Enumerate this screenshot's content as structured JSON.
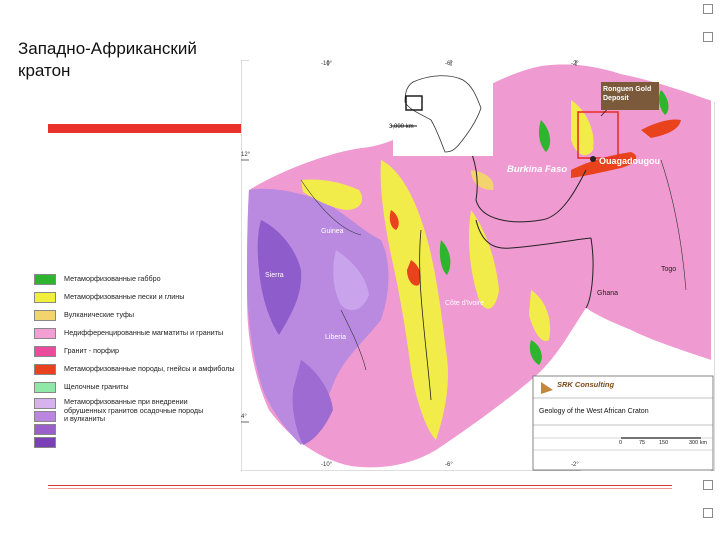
{
  "slide": {
    "title": "Западно-Африканский кратон"
  },
  "map": {
    "labels": {
      "burkina_faso": "Burkina Faso",
      "ouagadougou": "Ouagadougou",
      "deposit": "Ronguen Gold Deposit",
      "togo": "Togo",
      "ghana": "Ghana",
      "cote": "Côte d'Ivoire",
      "liberia": "Liberia",
      "guinea": "Guinea",
      "sierra": "Sierra"
    },
    "lat_labels": [
      "12°",
      "4°"
    ],
    "lon_labels_top": [
      "-10°",
      "-6°",
      "-2°"
    ],
    "lon_labels_bottom": [
      "-10°",
      "-6°",
      "-2°"
    ],
    "inset_scale": "3,000 km",
    "company": "SRK Consulting",
    "map_title": "Geology of the West African Craton",
    "scale_ticks": [
      "0",
      "75",
      "150",
      "300 km"
    ]
  },
  "legend": {
    "items": [
      {
        "label": "Метаморфизованные габбро",
        "color": "#2db52d"
      },
      {
        "label": "Метаморфизованные пески и глины",
        "color": "#f0f03c"
      },
      {
        "label": "Вулканические туфы",
        "color": "#f3d36e"
      },
      {
        "label": "Недифференцированные магматиты и граниты",
        "color": "#f2a0d4"
      },
      {
        "label": "Гранит - порфир",
        "color": "#ec4a9c"
      },
      {
        "label": "Метаморфизованные породы, гнейсы и амфиболы",
        "color": "#e8431d"
      },
      {
        "label": "Щелочные граниты",
        "color": "#8fe8a8"
      }
    ],
    "multi": {
      "colors": [
        "#d6b2ee",
        "#bb86e2",
        "#9b5fcc",
        "#7b3fb6"
      ],
      "text": "Метаморфизованные при внедрении обрушенных гранитов осадочные породы и вулканиты"
    }
  }
}
